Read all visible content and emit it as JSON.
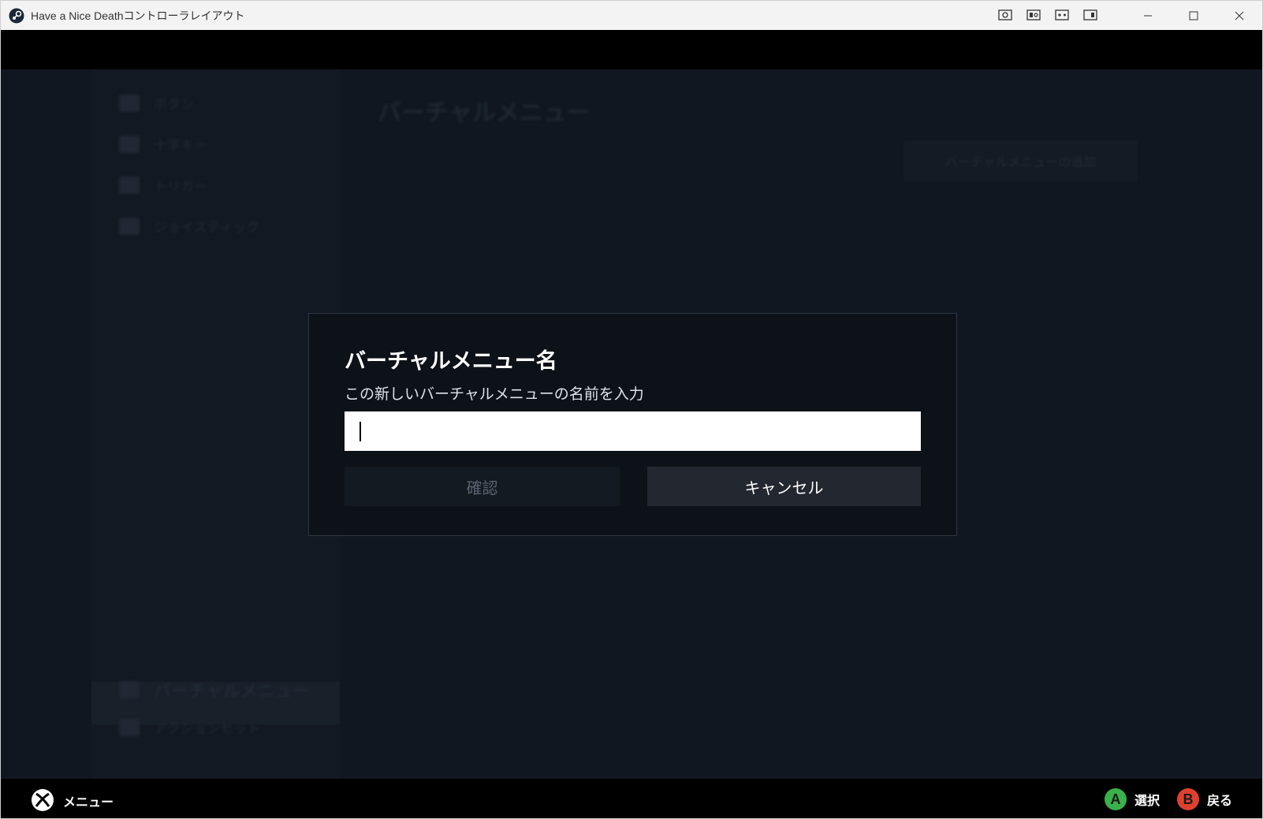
{
  "window": {
    "title": "Have a Nice Deathコントローラレイアウト"
  },
  "background": {
    "sidebar_items": [
      "ボタン",
      "十字キー",
      "トリガー",
      "ジョイスティック"
    ],
    "sidebar_bottom_items": [
      "バーチャルメニュー",
      "アクションセット"
    ],
    "page_title": "バーチャルメニュー",
    "add_button_label": "バーチャルメニューの追加"
  },
  "dialog": {
    "title": "バーチャルメニュー名",
    "subtitle": "この新しいバーチャルメニューの名前を入力",
    "input_value": "",
    "confirm_label": "確認",
    "cancel_label": "キャンセル"
  },
  "footer": {
    "menu_label": "メニュー",
    "a_glyph": "A",
    "a_label": "選択",
    "b_glyph": "B",
    "b_label": "戻る"
  },
  "colors": {
    "a_button": "#3ab14a",
    "b_button": "#e0412f",
    "dialog_bg": "#0d1218"
  }
}
